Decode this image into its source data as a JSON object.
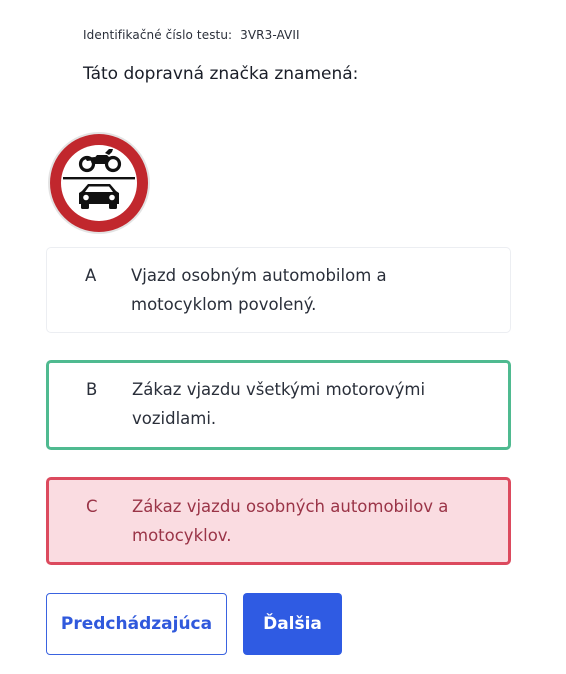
{
  "test": {
    "id_label": "Identifikačné číslo testu:",
    "id_value": "3VR3-AVII"
  },
  "question": {
    "text": "Táto dopravná značka znamená:",
    "sign_icon": "no-motor-vehicles-sign-icon"
  },
  "answers": [
    {
      "letter": "A",
      "text": "Vjazd osobným automobilom a motocyklom povolený.",
      "state": "neutral"
    },
    {
      "letter": "B",
      "text": "Zákaz vjazdu všetkými motorovými vozidlami.",
      "state": "correct"
    },
    {
      "letter": "C",
      "text": "Zákaz vjazdu osobných automobilov a motocyklov.",
      "state": "wrong"
    }
  ],
  "buttons": {
    "prev_label": "Predchádzajúca",
    "next_label": "Ďalšia"
  },
  "colors": {
    "correct": "#4fba90",
    "wrong": "#dc4a5e",
    "wrong_bg": "#fadce1",
    "primary": "#2f5be3",
    "sign_red": "#c1272d"
  }
}
